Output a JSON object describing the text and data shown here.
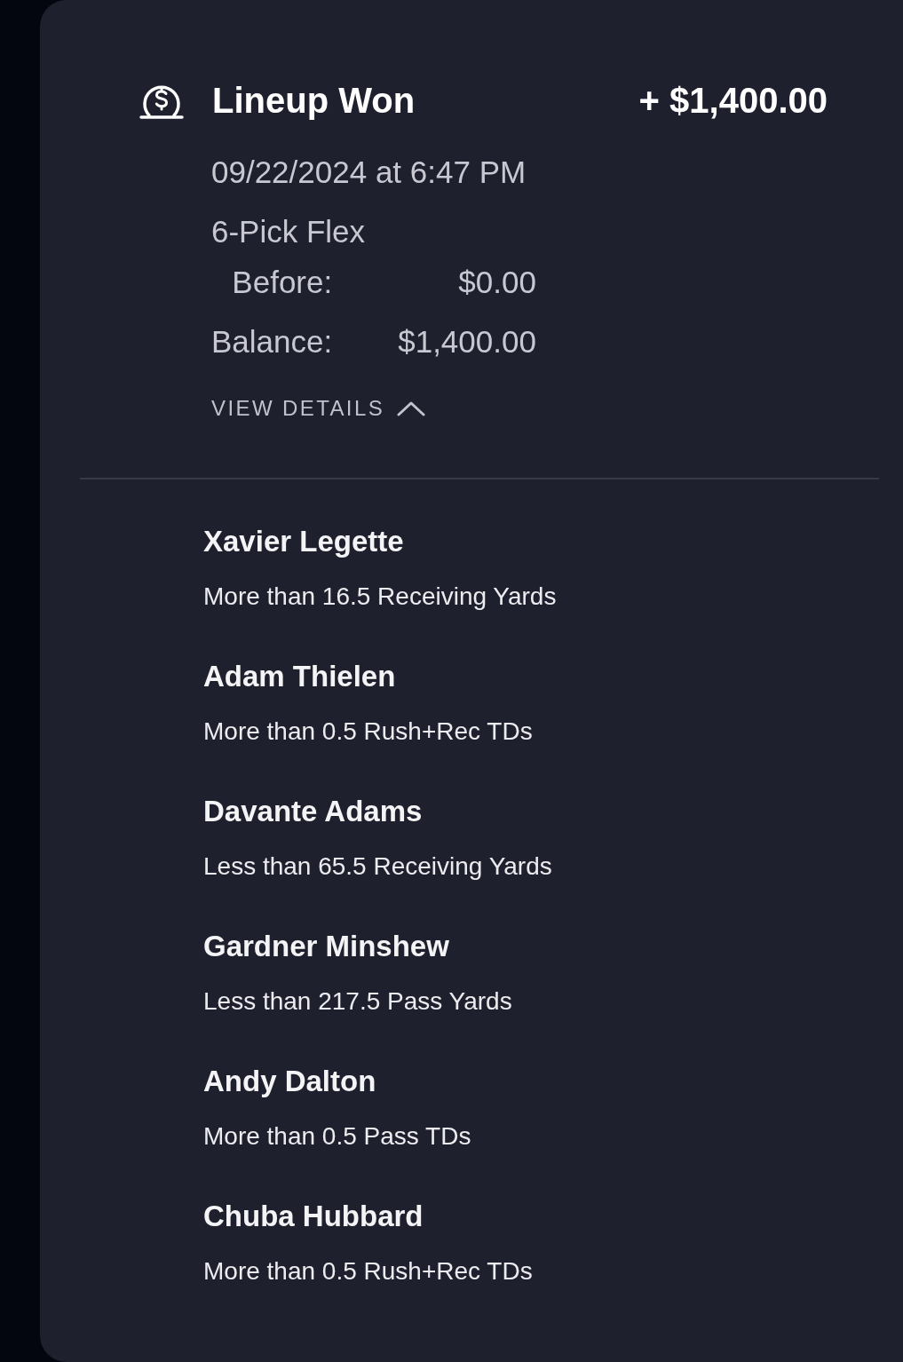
{
  "transaction": {
    "title": "Lineup Won",
    "amount": "+ $1,400.00",
    "date": "09/22/2024 at 6:47 PM",
    "lineup_type": "6-Pick Flex",
    "balances": [
      {
        "label": "Before:",
        "value": "$0.00"
      },
      {
        "label": "Balance:",
        "value": "$1,400.00"
      }
    ],
    "view_details": {
      "label": "VIEW DETAILS",
      "expanded": true
    }
  },
  "picks": [
    {
      "player": "Xavier Legette",
      "line": "More than 16.5 Receiving Yards"
    },
    {
      "player": "Adam Thielen",
      "line": "More than 0.5 Rush+Rec TDs"
    },
    {
      "player": "Davante Adams",
      "line": "Less than 65.5 Receiving Yards"
    },
    {
      "player": "Gardner Minshew",
      "line": "Less than 217.5 Pass Yards"
    },
    {
      "player": "Andy Dalton",
      "line": "More than 0.5 Pass TDs"
    },
    {
      "player": "Chuba Hubbard",
      "line": "More than 0.5 Rush+Rec TDs"
    }
  ]
}
